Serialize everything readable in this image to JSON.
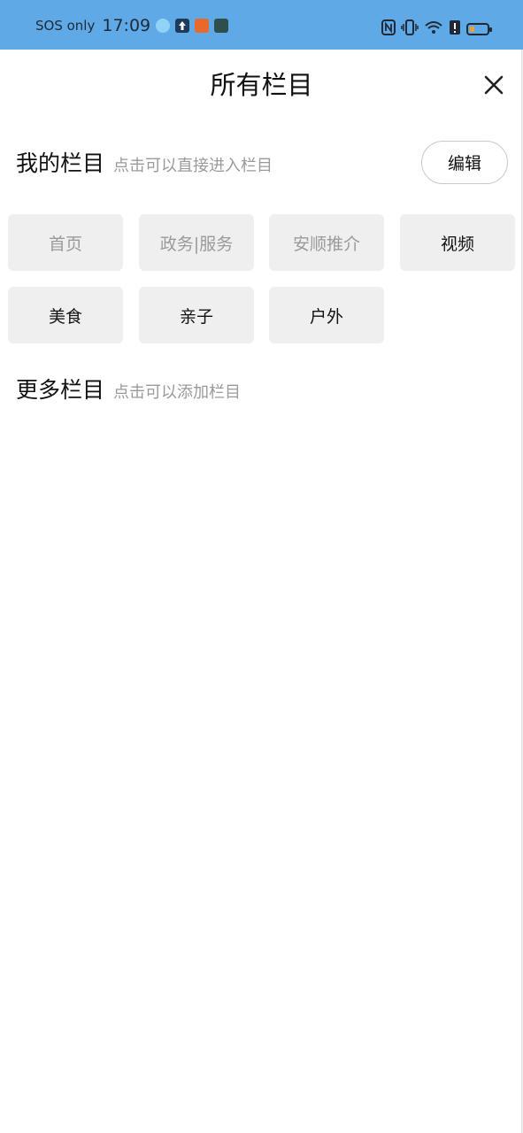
{
  "status_bar": {
    "carrier": "SOS only",
    "time": "17:09",
    "colors": {
      "background": "#5fa9e6"
    }
  },
  "header": {
    "title": "所有栏目",
    "close_icon": "close-icon"
  },
  "my_channels": {
    "title": "我的栏目",
    "hint": "点击可以直接进入栏目",
    "edit_label": "编辑",
    "items": [
      {
        "label": "首页",
        "fixed": true
      },
      {
        "label": "政务|服务",
        "fixed": true
      },
      {
        "label": "安顺推介",
        "fixed": true
      },
      {
        "label": "视频",
        "fixed": false
      },
      {
        "label": "美食",
        "fixed": false
      },
      {
        "label": "亲子",
        "fixed": false
      },
      {
        "label": "户外",
        "fixed": false
      }
    ]
  },
  "more_channels": {
    "title": "更多栏目",
    "hint": "点击可以添加栏目",
    "items": []
  }
}
